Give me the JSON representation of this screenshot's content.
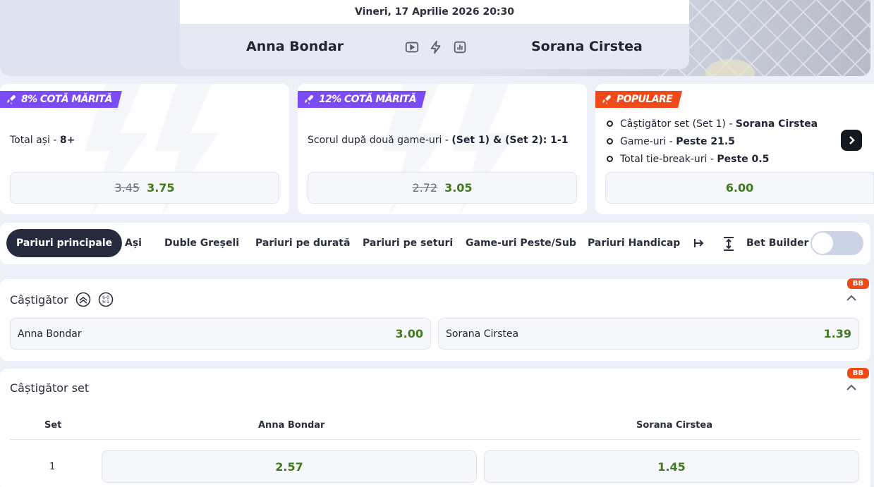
{
  "event": {
    "datetime": "Vineri, 17 Aprilie 2026 20:30",
    "home": "Anna Bondar",
    "away": "Sorana Cirstea",
    "icons": [
      "play-video-icon",
      "lightning-icon",
      "stats-icon"
    ]
  },
  "promos": [
    {
      "tag": "8% COTĂ MĂRITĂ",
      "market": "Total ași - ",
      "selection": "8+",
      "old_odd": "3.45",
      "new_odd": "3.75"
    },
    {
      "tag": "12% COTĂ MĂRITĂ",
      "market": "Scorul după două game-uri - ",
      "selection": "(Set 1) & (Set 2): 1-1",
      "old_odd": "2.72",
      "new_odd": "3.05"
    },
    {
      "tag": "POPULARE",
      "legs": [
        {
          "market": "Câștigător set (Set 1) - ",
          "selection": "Sorana Cirstea"
        },
        {
          "market": "Game-uri - ",
          "selection": "Peste 21.5"
        },
        {
          "market": "Total tie-break-uri - ",
          "selection": "Peste 0.5"
        }
      ],
      "odd": "6.00"
    }
  ],
  "tabs": [
    "Pariuri principale",
    "Ași",
    "Duble Greșeli",
    "Pariuri pe durată",
    "Pariuri pe seturi",
    "Game-uri Peste/Sub",
    "Pariuri Handicap"
  ],
  "bet_builder": {
    "label": "Bet Builder",
    "enabled": false
  },
  "markets": {
    "winner": {
      "title": "Câștigător",
      "badge": "BB",
      "selections": [
        {
          "name": "Anna Bondar",
          "odd": "3.00"
        },
        {
          "name": "Sorana Cirstea",
          "odd": "1.39"
        }
      ]
    },
    "set_winner": {
      "title": "Câștigător set",
      "badge": "BB",
      "headers": [
        "Set",
        "Anna Bondar",
        "Sorana Cirstea"
      ],
      "rows": [
        {
          "set": "1",
          "home_odd": "2.57",
          "away_odd": "1.45"
        }
      ]
    }
  },
  "colors": {
    "accent_purple": "#7b4cf6",
    "accent_red": "#f04a1a",
    "odd_green": "#3f7a1e",
    "active_tab": "#262b3e"
  }
}
